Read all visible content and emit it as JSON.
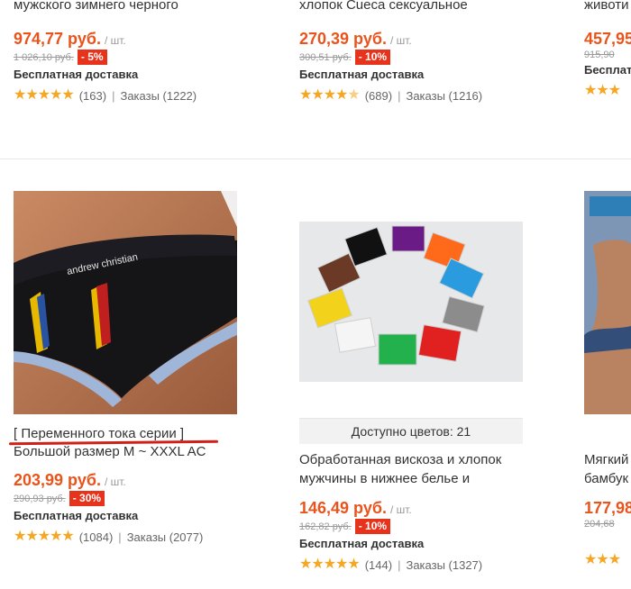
{
  "products_top": [
    {
      "title": "мужского зимнего черного",
      "price": "974,77 руб.",
      "unit": "/ шт.",
      "old_price": "1 026,10 руб.",
      "discount": "- 5%",
      "shipping": "Бесплатная доставка",
      "reviews": "(163)",
      "orders": "Заказы (1222)"
    },
    {
      "title": "хлопок Cueca сексуальное",
      "price": "270,39 руб.",
      "unit": "/ шт.",
      "old_price": "300,51 руб.",
      "discount": "- 10%",
      "shipping": "Бесплатная доставка",
      "reviews": "(689)",
      "orders": "Заказы (1216)"
    },
    {
      "title": "животи",
      "price": "457,95",
      "old_price": "915,90",
      "shipping": "Бесплат"
    }
  ],
  "products_bottom": [
    {
      "title_line1": "[ Переменного тока серии ]",
      "title_line2": "Большой размер M ~ XXXL AC",
      "price": "203,99 руб.",
      "unit": "/ шт.",
      "old_price": "290,93 руб.",
      "discount": "- 30%",
      "shipping": "Бесплатная доставка",
      "reviews": "(1084)",
      "orders": "Заказы (2077)",
      "brand_text": "andrew christian"
    },
    {
      "colors": "Доступно цветов: 21",
      "title_line1": "Обработанная вискоза и хлопок",
      "title_line2": "мужчины в нижнее белье и",
      "price": "146,49 руб.",
      "unit": "/ шт.",
      "old_price": "162,82 руб.",
      "discount": "- 10%",
      "shipping": "Бесплатная доставка",
      "reviews": "(144)",
      "orders": "Заказы (1327)"
    },
    {
      "title_line1": "Мягкий",
      "title_line2": "бамбук",
      "price": "177,98",
      "old_price": "204,68"
    }
  ],
  "separator": "|",
  "accent_color": "#e8541c",
  "discount_color": "#e8331c",
  "star_color": "#f5a623"
}
